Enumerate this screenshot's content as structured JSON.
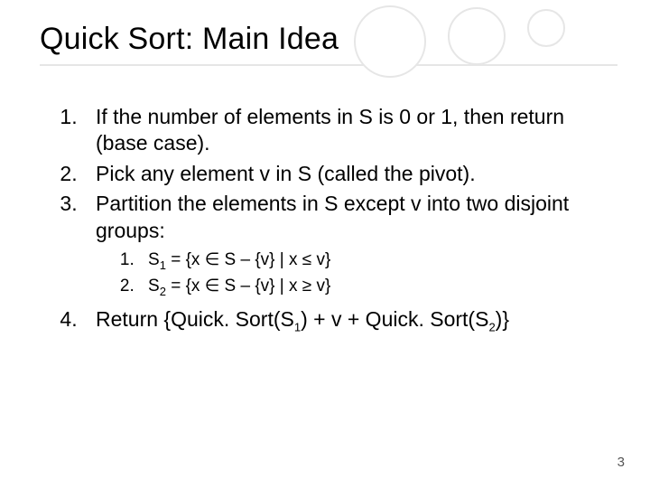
{
  "title": "Quick Sort: Main Idea",
  "steps": {
    "s1": "If the number of elements in S is 0 or 1, then return (base case).",
    "s2": "Pick any element v in S (called the pivot).",
    "s3": "Partition the elements in S except v into two disjoint groups:",
    "s3a_pre": "S",
    "s3a_sub": "1",
    "s3a_post": " = {x ∈ S – {v} | x ≤ v}",
    "s3b_pre": "S",
    "s3b_sub": "2",
    "s3b_post": " = {x ∈ S – {v} | x ≥ v}",
    "s4_a": "Return {Quick. Sort(S",
    "s4_b": "1",
    "s4_c": ") + v + Quick. Sort(S",
    "s4_d": "2",
    "s4_e": ")}"
  },
  "page_number": "3"
}
